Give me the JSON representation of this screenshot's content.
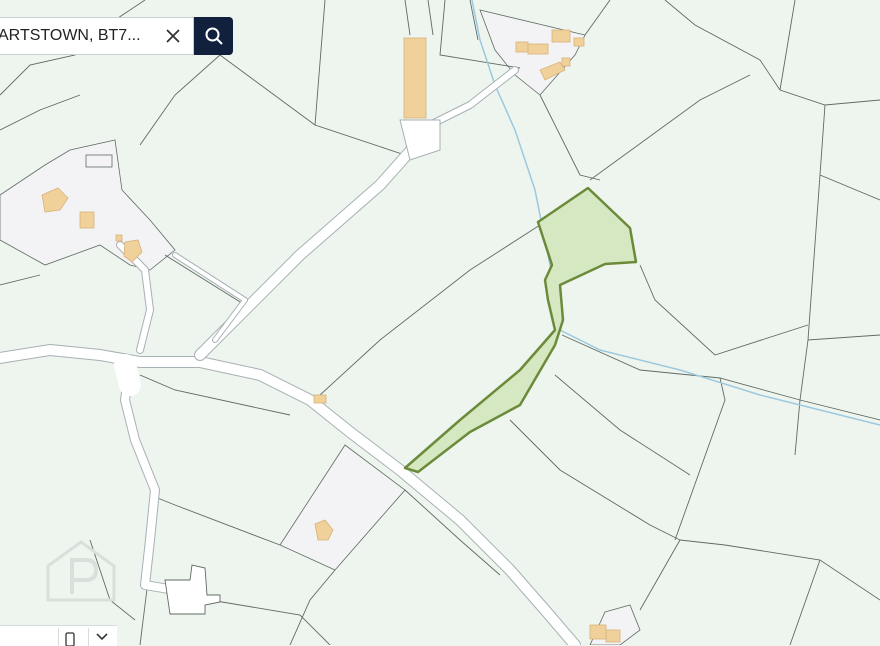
{
  "search": {
    "value": "ARTSTOWN, BT7...",
    "clear_label": "clear",
    "submit_label": "search"
  },
  "map": {
    "colors": {
      "land": "#eef5ee",
      "field_boundary": "#5f6b63",
      "road_fill": "#ffffff",
      "road_casing": "#a7b0b5",
      "building": "#f1d19a",
      "building_outline": "#d6b27a",
      "curtilage": "#f3f3f5",
      "stream": "#9cc9de",
      "highlight_fill": "#d6e8c2",
      "highlight_stroke": "#6b8a3a"
    },
    "highlighted_parcel": "selected-land-parcel"
  },
  "watermark": {
    "icon": "propertypal-logo-watermark"
  },
  "bottom_control": {
    "icons": [
      "phone-icon",
      "chevron-down-icon"
    ]
  }
}
